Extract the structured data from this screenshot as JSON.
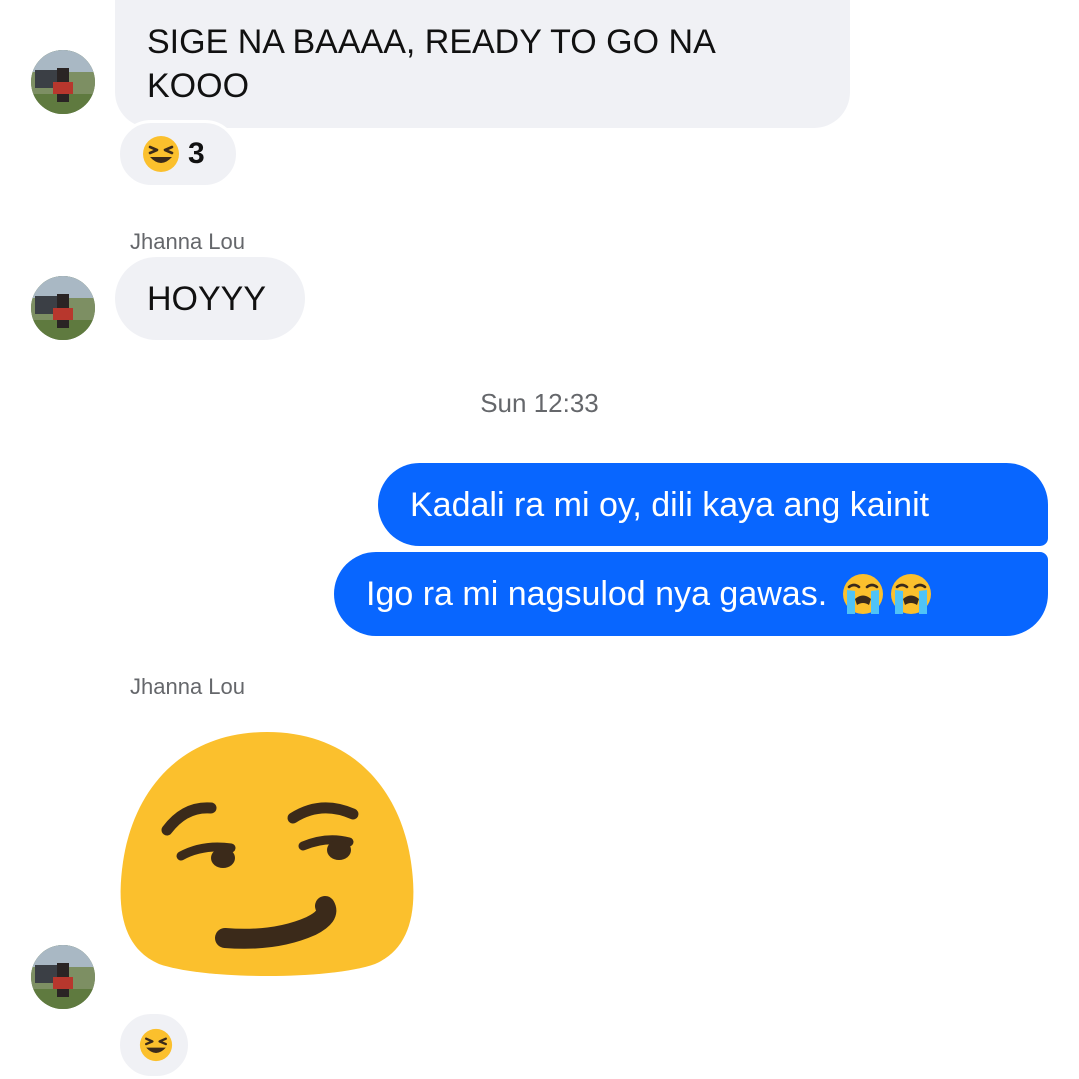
{
  "messages": [
    {
      "sender": "",
      "text": "SIGE NA BAAAA, READY TO GO NA KOOO",
      "reaction": {
        "emoji": "laughing-emoji",
        "count": "3"
      }
    },
    {
      "sender": "Jhanna Lou",
      "text": "HOYYY"
    },
    {
      "timestamp": "Sun 12:33"
    },
    {
      "outgoing": true,
      "text": "Kadali ra mi oy, dili kaya ang kainit"
    },
    {
      "outgoing": true,
      "text": "Igo ra mi nagsulod nya gawas.",
      "trailing_emojis": [
        "loudly-crying-emoji",
        "loudly-crying-emoji"
      ]
    },
    {
      "sender": "Jhanna Lou",
      "sticker": "smirking-face-emoji",
      "reaction": {
        "emoji": "laughing-emoji"
      }
    }
  ],
  "colors": {
    "outgoing_bubble": "#0866ff",
    "incoming_bubble": "#f0f1f5",
    "meta_text": "#65676b",
    "emoji_yellow": "#fbc02d"
  }
}
